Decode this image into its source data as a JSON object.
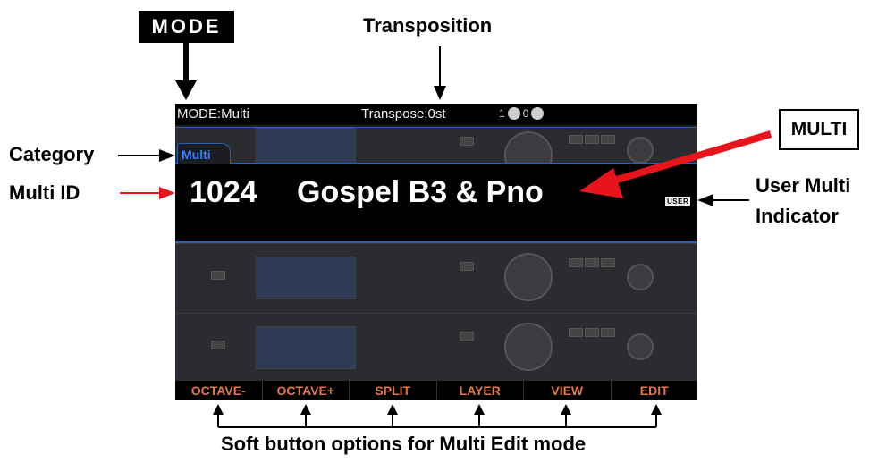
{
  "annotations": {
    "mode_key": "MODE",
    "transposition": "Transposition",
    "category": "Category",
    "multi_id": "Multi ID",
    "multi_box": "MULTI",
    "user_multi_1": "User Multi",
    "user_multi_2": "Indicator",
    "soft_caption": "Soft button options for Multi Edit mode"
  },
  "screen": {
    "mode": "MODE:Multi",
    "transpose": "Transpose:0st",
    "midi_1": "1",
    "midi_0": "0",
    "category_tab": "Multi",
    "multi_number": "1024",
    "multi_name": "Gospel B3 & Pno",
    "user_badge": "USER",
    "soft_buttons": [
      "OCTAVE-",
      "OCTAVE+",
      "SPLIT",
      "LAYER",
      "VIEW",
      "EDIT"
    ]
  },
  "colors": {
    "accent_blue": "#2a5fb8",
    "soft_label": "#e07a4a",
    "pointer_red": "#e8141b"
  },
  "icons": [
    "midi-indicator-icon",
    "arrow-icon"
  ]
}
